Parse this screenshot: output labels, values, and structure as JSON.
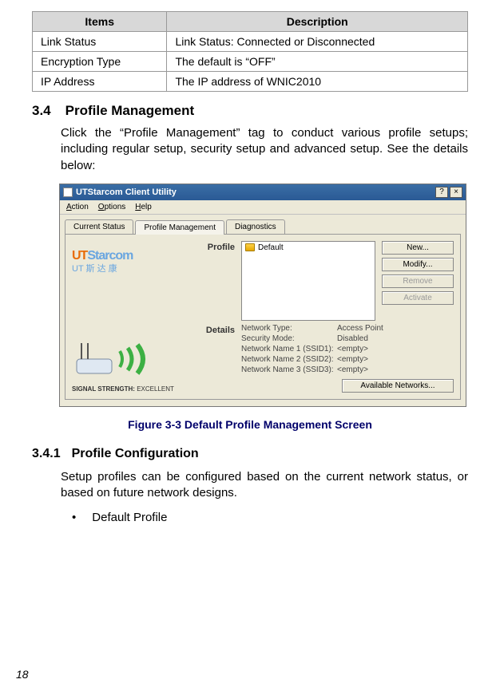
{
  "page_number": "18",
  "items_table": {
    "headers": [
      "Items",
      "Description"
    ],
    "rows": [
      {
        "item": "Link Status",
        "desc": "Link Status: Connected or Disconnected"
      },
      {
        "item": "Encryption Type",
        "desc": "The default is “OFF”"
      },
      {
        "item": "IP Address",
        "desc": "The IP address of WNIC2010"
      }
    ]
  },
  "section34": {
    "number": "3.4",
    "title": "Profile Management",
    "body": "Click the “Profile Management” tag to conduct various profile setups; including regular setup, security setup and advanced setup. See the details below:"
  },
  "app": {
    "title": "UTStarcom Client Utility",
    "help_btn": "?",
    "close_btn": "×",
    "menu": {
      "action": "Action",
      "options": "Options",
      "help": "Help"
    },
    "tabs": {
      "current": "Current Status",
      "profile": "Profile Management",
      "diag": "Diagnostics"
    },
    "logo": {
      "ut": "UT",
      "starcom": "Starcom",
      "cn": "UT 斯 达 康"
    },
    "signal": {
      "label": "SIGNAL STRENGTH:",
      "value": "EXCELLENT"
    },
    "labels": {
      "profile": "Profile",
      "details": "Details"
    },
    "profile_name": "Default",
    "buttons": {
      "new": "New...",
      "modify": "Modify...",
      "remove": "Remove",
      "activate": "Activate",
      "available": "Available Networks..."
    },
    "details": {
      "nt_label": "Network Type:",
      "nt_val": "Access Point",
      "sm_label": "Security Mode:",
      "sm_val": "Disabled",
      "s1_label": "Network Name 1 (SSID1):",
      "s1_val": "<empty>",
      "s2_label": "Network Name 2 (SSID2):",
      "s2_val": "<empty>",
      "s3_label": "Network Name 3 (SSID3):",
      "s3_val": "<empty>"
    }
  },
  "figure_caption": "Figure 3-3  Default Profile Management Screen",
  "section341": {
    "number": "3.4.1",
    "title": "Profile Configuration",
    "body": "Setup profiles can be configured based on the current network status, or based on future network designs.",
    "bullet1": "Default Profile"
  }
}
